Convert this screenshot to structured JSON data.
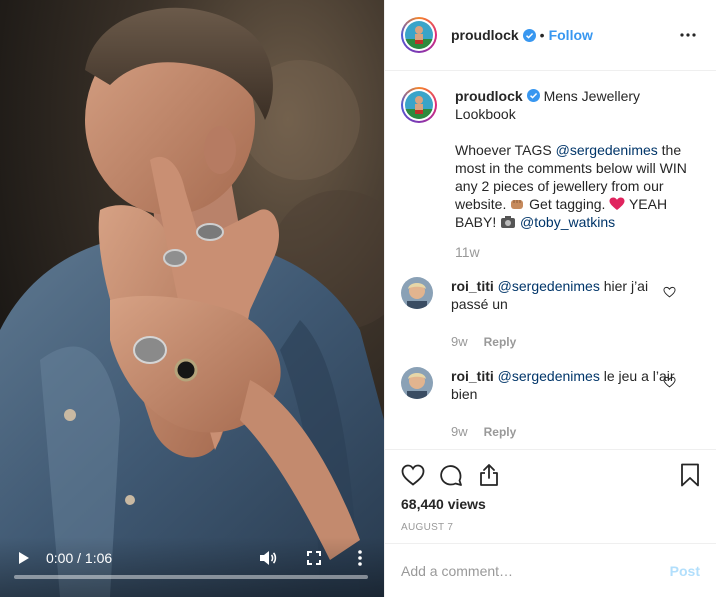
{
  "video": {
    "time_display": "0:00 / 1:06",
    "progress_fraction": 0.0,
    "icons": [
      "play-icon",
      "volume-icon",
      "fullscreen-icon",
      "more-vertical-icon"
    ]
  },
  "header": {
    "username": "proudlock",
    "separator": "•",
    "follow_label": "Follow",
    "icons": [
      "verified-badge-icon",
      "more-horizontal-icon"
    ]
  },
  "caption": {
    "username": "proudlock",
    "title_text": "Mens Jewellery Lookbook",
    "line1_pre": "Whoever TAGS ",
    "line1_mention": "@sergedenimes",
    "line1_post": " the most in the comments below will WIN any 2 pieces of jewellery from our website. ",
    "part_tagging": " Get tagging. ",
    "part_yeah": " YEAH BABY! ",
    "mention2": "@toby_watkins",
    "age": "11w"
  },
  "comments": [
    {
      "username": "roi_titi",
      "mention": "@sergedenimes",
      "text": " hier j’ai passé un",
      "age": "9w",
      "reply_label": "Reply"
    },
    {
      "username": "roi_titi",
      "mention": "@sergedenimes",
      "text": " le jeu a l’air bien",
      "age": "9w",
      "reply_label": "Reply"
    }
  ],
  "actions": {
    "views": "68,440 views",
    "date": "AUGUST 7",
    "icons": [
      "heart-icon",
      "comment-icon",
      "share-icon",
      "bookmark-icon"
    ]
  },
  "composer": {
    "placeholder": "Add a comment…",
    "post_label": "Post"
  },
  "colors": {
    "link_blue": "#3897f0",
    "mention": "#003569",
    "muted": "#999999",
    "post_disabled": "#b2dffc",
    "heart_emoji": "#e0245e"
  }
}
